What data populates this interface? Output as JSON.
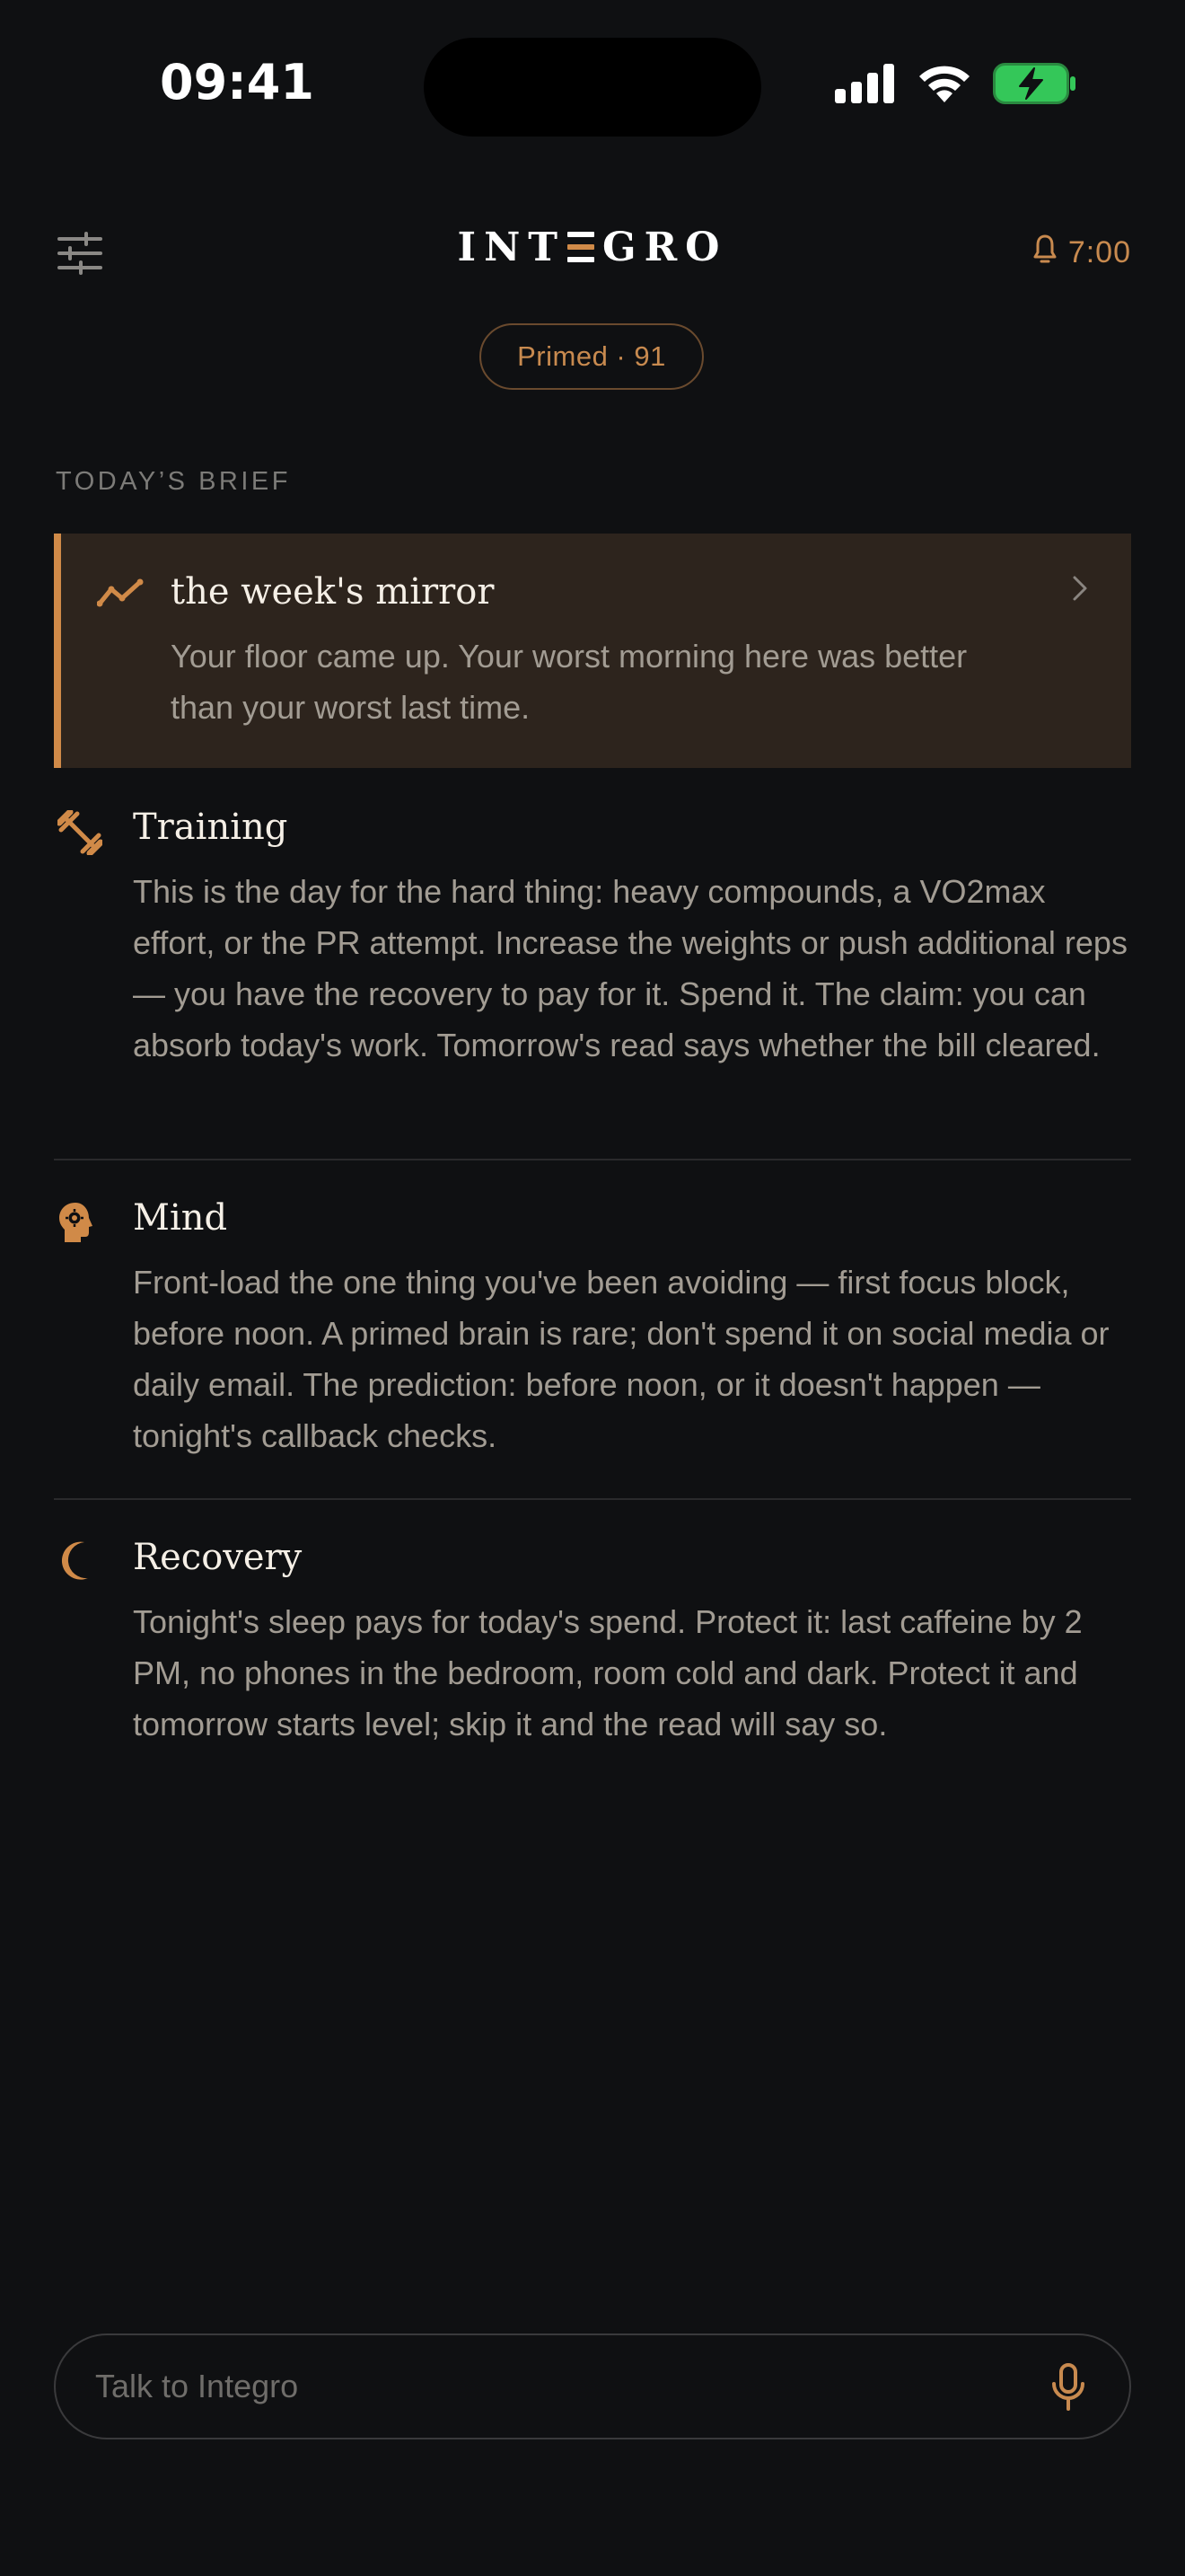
{
  "status_bar": {
    "time": "09:41",
    "icons": [
      "cellular-signal-icon",
      "wifi-icon",
      "battery-charging-icon"
    ]
  },
  "header": {
    "brand": {
      "before": "INT",
      "after": "GRO"
    },
    "alarm_time": "7:00",
    "icons": [
      "sliders-icon",
      "bell-icon"
    ]
  },
  "state_chip": "Primed · 91",
  "section_label": "TODAY’S BRIEF",
  "mirror": {
    "title": "the week's mirror",
    "body": "Your floor came up. Your worst morning here was better than your worst last time.",
    "icon": "trend-line-icon"
  },
  "brief": [
    {
      "icon": "dumbbell-icon",
      "title": "Training",
      "body": "This is the day for the hard thing: heavy compounds, a VO2max effort, or the PR attempt. Increase the weights or push additional reps — you have the recovery to pay for it. Spend it. The claim: you can absorb today's work. Tomorrow's read says whether the bill cleared."
    },
    {
      "icon": "head-gear-icon",
      "title": "Mind",
      "body": "Front-load the one thing you've been avoiding — first focus block, before noon. A primed brain is rare; don't spend it on social media or daily email. The prediction: before noon, or it doesn't happen — tonight's callback checks."
    },
    {
      "icon": "moon-icon",
      "title": "Recovery",
      "body": "Tonight's sleep pays for today's spend. Protect it: last caffeine by 2 PM, no phones in the bedroom, room cold and dark. Protect it and tomorrow starts level; skip it and the read will say so."
    }
  ],
  "chat": {
    "placeholder": "Talk to Integro",
    "icon": "microphone-icon"
  },
  "colors": {
    "background": "#0f1012",
    "accent": "#c88a4f",
    "card": "#2d241d",
    "card_border": "#d08a48",
    "battery": "#34c759"
  }
}
